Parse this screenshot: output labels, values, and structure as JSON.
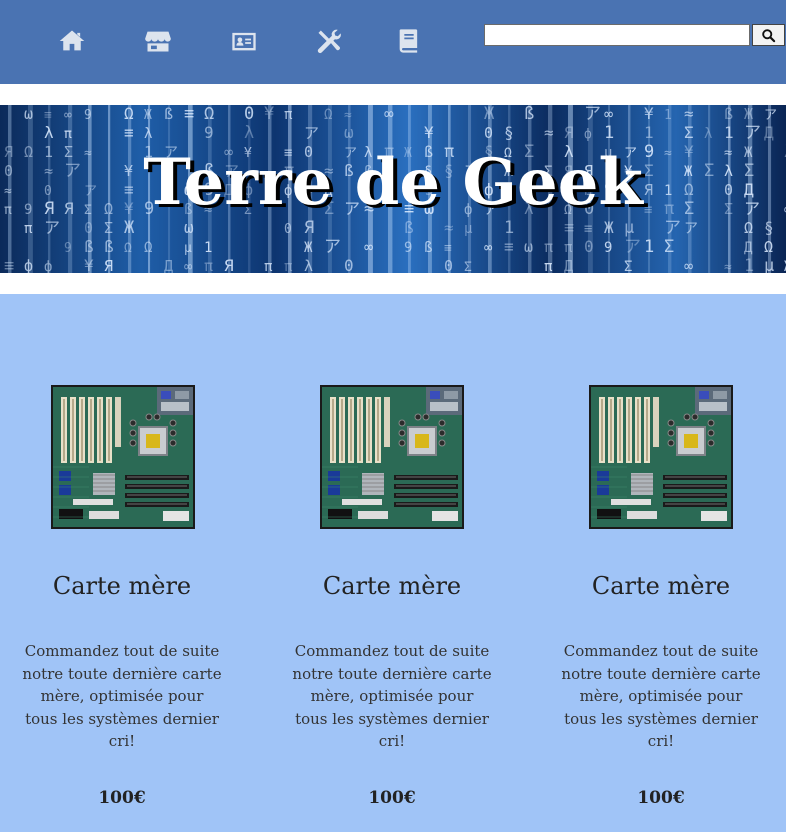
{
  "nav": {
    "items": [
      {
        "icon": "home-icon"
      },
      {
        "icon": "store-icon"
      },
      {
        "icon": "contact-card-icon"
      },
      {
        "icon": "tools-icon"
      },
      {
        "icon": "book-icon"
      }
    ],
    "search": {
      "value": "",
      "placeholder": "",
      "button_icon": "search-icon"
    },
    "colors": {
      "bar": "#4a73b2",
      "icon": "#dde4ee"
    }
  },
  "banner": {
    "title": "Terre de Geek"
  },
  "products": {
    "background": "#a0c4f7",
    "items": [
      {
        "title": "Carte mère",
        "description": "Commandez tout de suite notre toute dernière carte mère, optimisée pour tous les systèmes dernier cri!",
        "price": "100€",
        "image": "motherboard-image"
      },
      {
        "title": "Carte mère",
        "description": "Commandez tout de suite notre toute dernière carte mère, optimisée pour tous les systèmes dernier cri!",
        "price": "100€",
        "image": "motherboard-image"
      },
      {
        "title": "Carte mère",
        "description": "Commandez tout de suite notre toute dernière carte mère, optimisée pour tous les systèmes dernier cri!",
        "price": "100€",
        "image": "motherboard-image"
      }
    ]
  }
}
